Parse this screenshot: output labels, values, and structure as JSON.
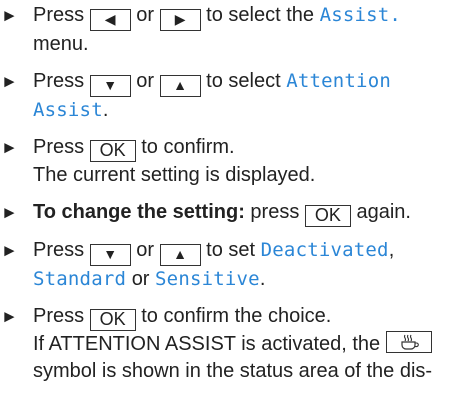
{
  "steps": [
    {
      "lines": [
        {
          "pre": "Press",
          "key1": "◀",
          "mid": "or",
          "key2": "▶",
          "post": "to select the",
          "disp": "Assist.",
          "end": ""
        },
        {
          "text": "menu."
        }
      ]
    },
    {
      "lines": [
        {
          "pre": "Press",
          "key1": "▼",
          "mid": "or",
          "key2": "▲",
          "post": "to select",
          "disp": "Attention"
        },
        {
          "disp": "Assist",
          "end": "."
        }
      ]
    },
    {
      "lines": [
        {
          "pre": "Press",
          "key": "OK",
          "post": "to confirm."
        },
        {
          "text": "The current setting is displayed."
        }
      ]
    },
    {
      "lines": [
        {
          "bold": "To change the setting:",
          "pre": "press",
          "key": "OK",
          "post": "again."
        }
      ]
    },
    {
      "lines": [
        {
          "pre": "Press",
          "key1": "▼",
          "mid": "or",
          "key2": "▲",
          "post": "to set",
          "disp": "Deactivated",
          "end": ","
        },
        {
          "disp1": "Standard",
          "mid": "or",
          "disp2": "Sensitive",
          "end": "."
        }
      ]
    },
    {
      "lines": [
        {
          "pre": "Press",
          "key": "OK",
          "post": "to confirm the choice."
        },
        {
          "pre": "If ATTENTION ASSIST is activated, the"
        },
        {
          "text": "symbol is shown in the status area of the dis-"
        }
      ]
    }
  ],
  "bullet": "►",
  "symbol_icon": "coffee-cup-icon"
}
